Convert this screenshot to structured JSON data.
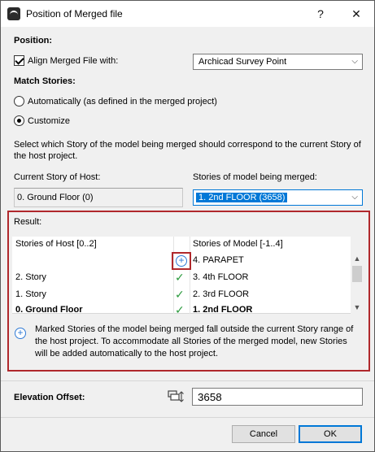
{
  "window": {
    "title": "Position of Merged file",
    "help": "?",
    "close": "✕"
  },
  "position": {
    "heading": "Position:",
    "align_label": "Align Merged File with:",
    "align_checked": true,
    "align_value": "Archicad Survey Point"
  },
  "match": {
    "heading": "Match Stories:",
    "auto_label": "Automatically (as defined in the merged project)",
    "custom_label": "Customize",
    "selected": "custom",
    "description": "Select which Story of the model being merged should correspond to the current Story of the host project."
  },
  "host": {
    "label": "Current Story of Host:",
    "value": "0. Ground Floor (0)"
  },
  "merged": {
    "label": "Stories of model being merged:",
    "value": "1. 2nd FLOOR (3658)"
  },
  "result": {
    "heading": "Result:",
    "host_header": "Stories of Host [0..2]",
    "model_header": "Stories of Model [-1..4]",
    "rows": [
      {
        "host": "",
        "mark": "plus",
        "model": "4. PARAPET"
      },
      {
        "host": "2. Story",
        "mark": "✓",
        "model": "3. 4th FLOOR"
      },
      {
        "host": "1. Story",
        "mark": "✓",
        "model": "2. 3rd FLOOR"
      },
      {
        "host": "0. Ground Floor",
        "mark": "✓",
        "model": "1. 2nd FLOOR"
      }
    ],
    "note": "Marked Stories of the model being merged fall outside the current Story range of the host project. To accommodate all Stories of the merged model, new Stories will be added automatically to the host project.",
    "accent_color": "#b0282c"
  },
  "elevation": {
    "label": "Elevation Offset:",
    "value": "3658"
  },
  "buttons": {
    "cancel": "Cancel",
    "ok": "OK"
  },
  "icons": {
    "plus": "+",
    "check": "✓",
    "scroll_up": "▲",
    "scroll_down": "▼",
    "combo_arrow": "⌵"
  }
}
